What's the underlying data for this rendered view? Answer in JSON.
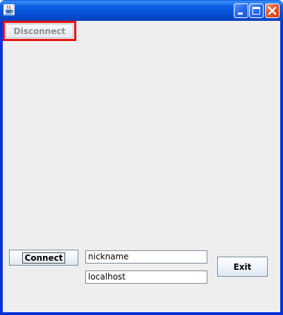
{
  "window": {
    "title": "",
    "controls": [
      "minimize-icon",
      "maximize-icon",
      "close-icon"
    ],
    "app_icon": "java-cup-icon"
  },
  "buttons": {
    "connect_label": "Connect",
    "disconnect_label": "Disconnect",
    "exit_label": "Exit"
  },
  "fields": {
    "nickname_value": "nickname",
    "host_value": "localhost"
  },
  "state": {
    "disconnect_enabled": false,
    "highlight_color": "#e8140f"
  }
}
